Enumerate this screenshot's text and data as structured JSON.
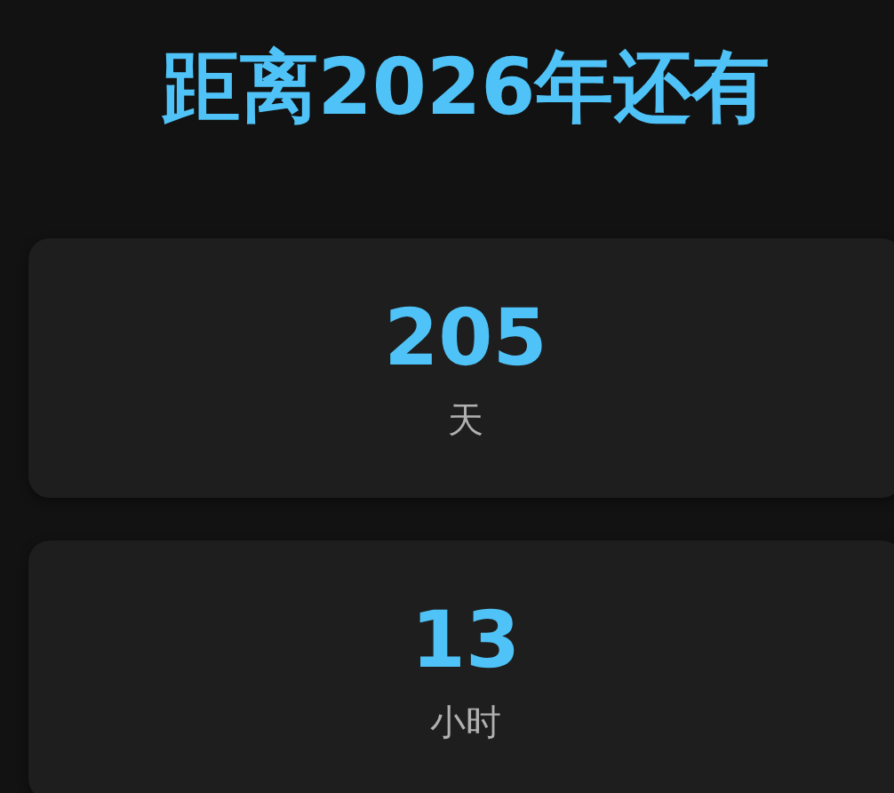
{
  "title": "距离2026年还有",
  "units": [
    {
      "value": "205",
      "label": "天"
    },
    {
      "value": "13",
      "label": "小时"
    }
  ]
}
